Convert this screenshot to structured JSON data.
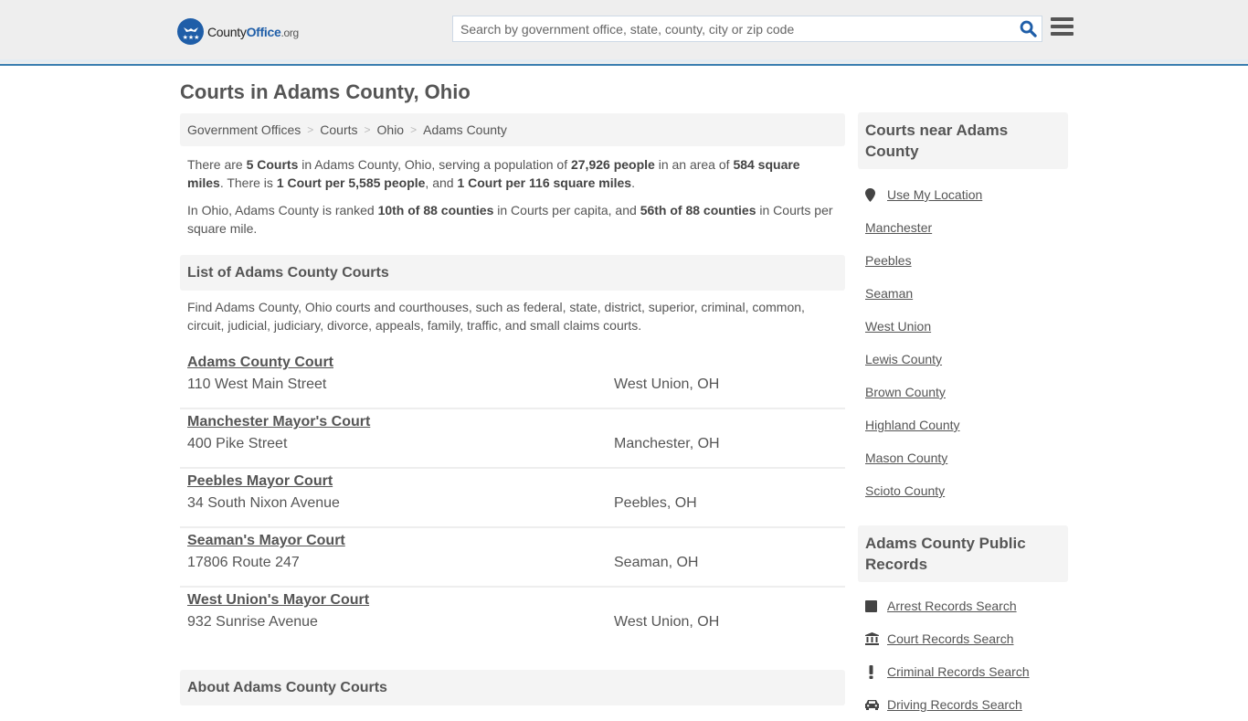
{
  "header": {
    "logo": {
      "name_part1": "County",
      "name_part2": "Office",
      "name_part3": ".org",
      "brand_color": "#1f5ea8"
    },
    "search": {
      "placeholder": "Search by government office, state, county, city or zip code",
      "value": ""
    },
    "accent_color": "#3a7eb0"
  },
  "page_title": "Courts in Adams County, Ohio",
  "breadcrumb": [
    "Government Offices",
    "Courts",
    "Ohio",
    "Adams County"
  ],
  "intro": {
    "p1": {
      "t1": "There are ",
      "b1": "5 Courts",
      "t2": " in Adams County, Ohio, serving a population of ",
      "b2": "27,926 people",
      "t3": " in an area of ",
      "b3": "584 square miles",
      "t4": ". There is ",
      "b4": "1 Court per 5,585 people",
      "t5": ", and ",
      "b5": "1 Court per 116 square miles",
      "t6": "."
    },
    "p2": {
      "t1": "In Ohio, Adams County is ranked ",
      "b1": "10th of 88 counties",
      "t2": " in Courts per capita, and ",
      "b2": "56th of 88 counties",
      "t3": " in Courts per square mile."
    }
  },
  "list_section": {
    "heading": "List of Adams County Courts",
    "description": "Find Adams County, Ohio courts and courthouses, such as federal, state, district, superior, criminal, common, circuit, judicial, judiciary, divorce, appeals, family, traffic, and small claims courts.",
    "courts": [
      {
        "name": "Adams County Court",
        "address": "110 West Main Street",
        "city": "West Union, OH"
      },
      {
        "name": "Manchester Mayor's Court",
        "address": "400 Pike Street",
        "city": "Manchester, OH"
      },
      {
        "name": "Peebles Mayor Court",
        "address": "34 South Nixon Avenue",
        "city": "Peebles, OH"
      },
      {
        "name": "Seaman's Mayor Court",
        "address": "17806 Route 247",
        "city": "Seaman, OH"
      },
      {
        "name": "West Union's Mayor Court",
        "address": "932 Sunrise Avenue",
        "city": "West Union, OH"
      }
    ]
  },
  "about_section": {
    "heading": "About Adams County Courts"
  },
  "sidebar": {
    "near": {
      "heading": "Courts near Adams County",
      "use_location": {
        "label": "Use My Location",
        "icon": "map-marker-icon"
      },
      "links": [
        "Manchester",
        "Peebles",
        "Seaman",
        "West Union",
        "Lewis County",
        "Brown County",
        "Highland County",
        "Mason County",
        "Scioto County"
      ]
    },
    "records": {
      "heading": "Adams County Public Records",
      "links": [
        {
          "label": "Arrest Records Search",
          "icon": "square-icon"
        },
        {
          "label": "Court Records Search",
          "icon": "courthouse-icon"
        },
        {
          "label": "Criminal Records Search",
          "icon": "exclamation-icon"
        },
        {
          "label": "Driving Records Search",
          "icon": "car-icon"
        }
      ]
    }
  }
}
